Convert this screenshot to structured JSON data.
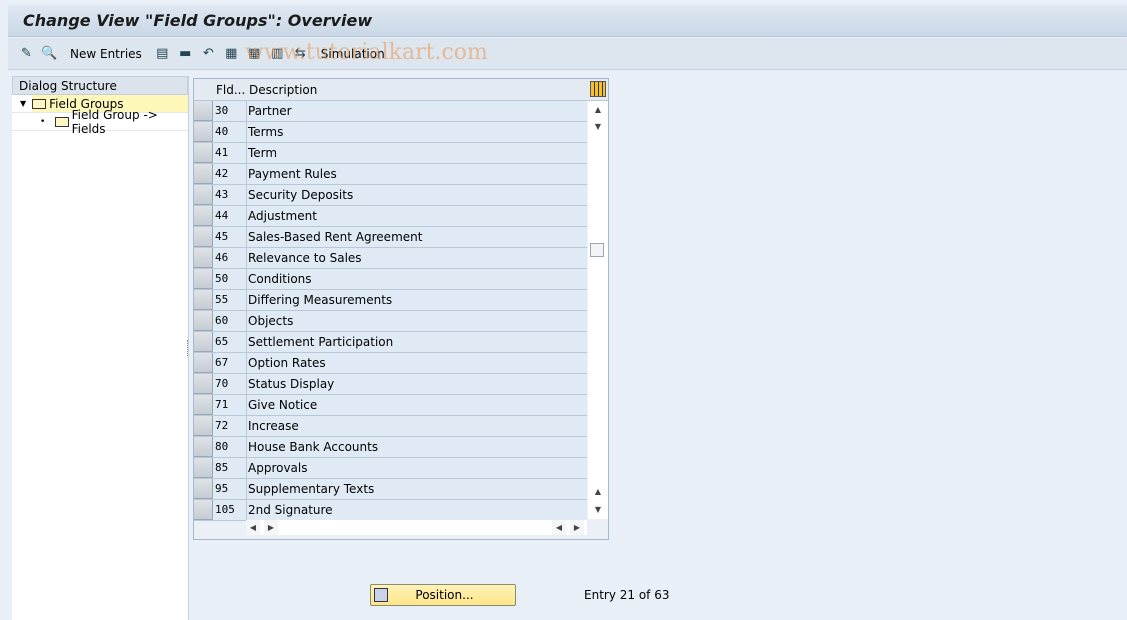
{
  "title": "Change View \"Field Groups\": Overview",
  "watermark": "www.tutorialkart.com",
  "toolbar": {
    "new_entries": "New Entries",
    "simulation": "Simulation",
    "icons": [
      "edit-display-icon",
      "details-icon",
      "copy-icon",
      "delete-icon",
      "undo-icon",
      "select-all-icon",
      "select-block-icon",
      "deselect-all-icon",
      "transport-icon"
    ]
  },
  "dialog": {
    "header": "Dialog Structure",
    "items": [
      {
        "label": "Field Groups",
        "selected": true
      },
      {
        "label": "Field Group -> Fields",
        "selected": false
      }
    ]
  },
  "table": {
    "col_id": "Fld...",
    "col_desc": "Description",
    "rows": [
      {
        "id": "30",
        "desc": "Partner"
      },
      {
        "id": "40",
        "desc": "Terms"
      },
      {
        "id": "41",
        "desc": "Term"
      },
      {
        "id": "42",
        "desc": "Payment Rules"
      },
      {
        "id": "43",
        "desc": "Security Deposits"
      },
      {
        "id": "44",
        "desc": "Adjustment"
      },
      {
        "id": "45",
        "desc": "Sales-Based Rent Agreement"
      },
      {
        "id": "46",
        "desc": "Relevance to Sales"
      },
      {
        "id": "50",
        "desc": "Conditions"
      },
      {
        "id": "55",
        "desc": "Differing Measurements"
      },
      {
        "id": "60",
        "desc": "Objects"
      },
      {
        "id": "65",
        "desc": "Settlement Participation"
      },
      {
        "id": "67",
        "desc": "Option Rates"
      },
      {
        "id": "70",
        "desc": "Status Display"
      },
      {
        "id": "71",
        "desc": "Give Notice"
      },
      {
        "id": "72",
        "desc": "Increase"
      },
      {
        "id": "80",
        "desc": "House Bank Accounts"
      },
      {
        "id": "85",
        "desc": "Approvals"
      },
      {
        "id": "95",
        "desc": "Supplementary Texts"
      },
      {
        "id": "105",
        "desc": "2nd Signature"
      }
    ]
  },
  "footer": {
    "position": "Position...",
    "entry": "Entry 21 of 63"
  }
}
